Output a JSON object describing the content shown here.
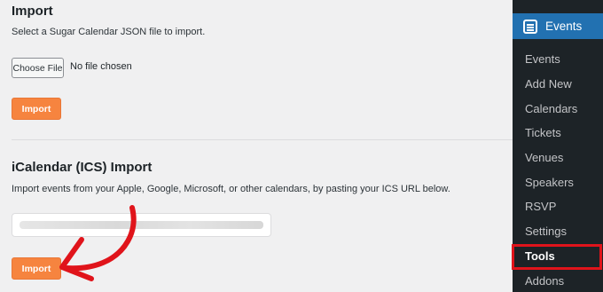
{
  "import_section": {
    "title": "Import",
    "description": "Select a Sugar Calendar JSON file to import.",
    "choose_file_label": "Choose File",
    "file_status": "No file chosen",
    "import_button": "Import"
  },
  "ics_section": {
    "title": "iCalendar (ICS) Import",
    "description": "Import events from your Apple, Google, Microsoft, or other calendars, by pasting your ICS URL below.",
    "import_button": "Import"
  },
  "sidebar": {
    "header": "Events",
    "items": [
      {
        "label": "Events"
      },
      {
        "label": "Add New"
      },
      {
        "label": "Calendars"
      },
      {
        "label": "Tickets"
      },
      {
        "label": "Venues"
      },
      {
        "label": "Speakers"
      },
      {
        "label": "RSVP"
      },
      {
        "label": "Settings"
      },
      {
        "label": "Tools"
      },
      {
        "label": "Addons"
      }
    ],
    "active_item": "Tools"
  },
  "colors": {
    "accent_button": "#f6843f",
    "sidebar_bg": "#1d2327",
    "sidebar_header_bg": "#2271b1",
    "annotation_red": "#e0141b"
  }
}
